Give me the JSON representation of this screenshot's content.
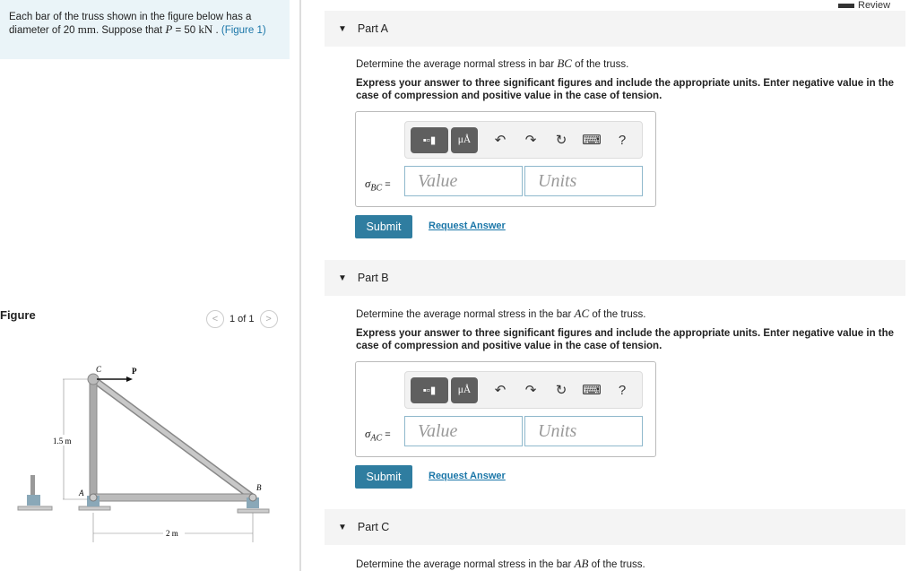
{
  "problem": {
    "text1": "Each bar of the truss shown in the figure below has a diameter of 20 ",
    "unit_mm": "mm",
    "text2": ". Suppose that ",
    "var_p": "P",
    "text3": " = 50 ",
    "unit_kn": "kN",
    "text4": " . ",
    "figure_link": "(Figure 1)"
  },
  "figure": {
    "label": "Figure",
    "pager": "1 of 1",
    "labels": {
      "c": "C",
      "p": "P",
      "a": "A",
      "b": "B",
      "height": "1.5 m",
      "width": "2 m"
    }
  },
  "review": "Review",
  "parts": [
    {
      "title": "Part A",
      "question_pre": "Determine the average normal stress in bar ",
      "bar": "BC",
      "question_post": " of the truss.",
      "instructions": "Express your answer to three significant figures and include the appropriate units. Enter negative value in the case of compression and positive value in the case of tension.",
      "sigma": "σ",
      "sub": "BC",
      "eq": " =",
      "value_placeholder": "Value",
      "units_placeholder": "Units",
      "submit": "Submit",
      "request": "Request Answer"
    },
    {
      "title": "Part B",
      "question_pre": "Determine the average normal stress in the bar ",
      "bar": "AC",
      "question_post": " of the truss.",
      "instructions": "Express your answer to three significant figures and include the appropriate units. Enter negative value in the case of compression and positive value in the case of tension.",
      "sigma": "σ",
      "sub": "AC",
      "eq": " =",
      "value_placeholder": "Value",
      "units_placeholder": "Units",
      "submit": "Submit",
      "request": "Request Answer"
    },
    {
      "title": "Part C",
      "question_pre": "Determine the average normal stress in the bar ",
      "bar": "AB",
      "question_post": " of the truss."
    }
  ],
  "toolbar": {
    "units_btn": "μÅ",
    "help": "?",
    "icons": [
      "templates-icon",
      "units-icon",
      "undo-icon",
      "redo-icon",
      "reset-icon",
      "keyboard-icon",
      "help-icon"
    ]
  },
  "colors": {
    "accent": "#2f7da0",
    "info_bg": "#eaf4f8",
    "link": "#1a76a8"
  }
}
